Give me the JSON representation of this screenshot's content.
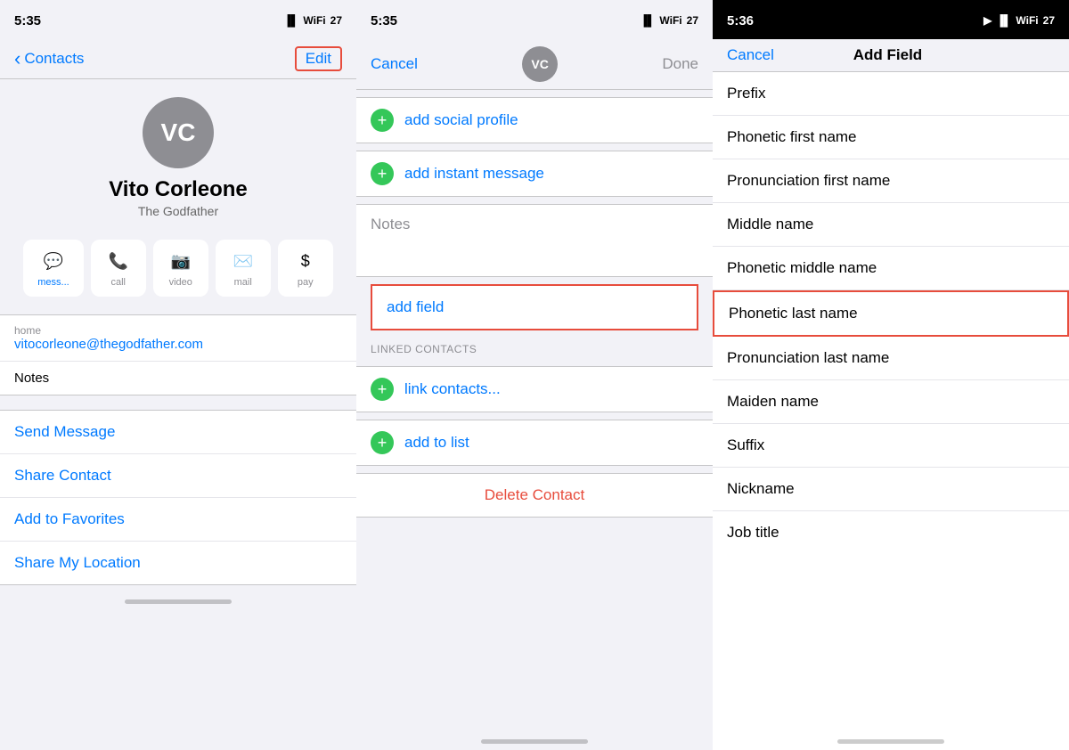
{
  "panel1": {
    "status_time": "5:35",
    "nav_back": "Contacts",
    "nav_edit": "Edit",
    "avatar_initials": "VC",
    "contact_name": "Vito Corleone",
    "contact_subtitle": "The Godfather",
    "actions": [
      {
        "id": "message",
        "icon": "💬",
        "label": "mess...",
        "active": true
      },
      {
        "id": "call",
        "icon": "📞",
        "label": "call",
        "active": false
      },
      {
        "id": "video",
        "icon": "📷",
        "label": "video",
        "active": false
      },
      {
        "id": "mail",
        "icon": "✉️",
        "label": "mail",
        "active": false
      },
      {
        "id": "pay",
        "icon": "$",
        "label": "pay",
        "active": false
      }
    ],
    "info_label": "home",
    "info_email": "vitocorleone@thegodfather.com",
    "notes_label": "Notes",
    "links": [
      "Send Message",
      "Share Contact",
      "Add to Favorites",
      "Share My Location"
    ]
  },
  "panel2": {
    "status_time": "5:35",
    "nav_cancel": "Cancel",
    "nav_done": "Done",
    "avatar_initials": "VC",
    "rows": [
      {
        "type": "add",
        "text": "add social profile"
      },
      {
        "type": "add",
        "text": "add instant message"
      }
    ],
    "notes_label": "Notes",
    "add_field_label": "add field",
    "linked_header": "LINKED CONTACTS",
    "linked_rows": [
      {
        "text": "link contacts..."
      },
      {
        "text": "add to list"
      }
    ],
    "delete_label": "Delete Contact"
  },
  "panel3": {
    "status_time": "5:36",
    "nav_cancel": "Cancel",
    "nav_title": "Add Field",
    "fields": [
      {
        "label": "Prefix",
        "highlighted": false
      },
      {
        "label": "Phonetic first name",
        "highlighted": false
      },
      {
        "label": "Pronunciation first name",
        "highlighted": false
      },
      {
        "label": "Middle name",
        "highlighted": false
      },
      {
        "label": "Phonetic middle name",
        "highlighted": false
      },
      {
        "label": "Phonetic last name",
        "highlighted": true
      },
      {
        "label": "Pronunciation last name",
        "highlighted": false
      },
      {
        "label": "Maiden name",
        "highlighted": false
      },
      {
        "label": "Suffix",
        "highlighted": false
      },
      {
        "label": "Nickname",
        "highlighted": false
      },
      {
        "label": "Job title",
        "highlighted": false
      }
    ]
  }
}
